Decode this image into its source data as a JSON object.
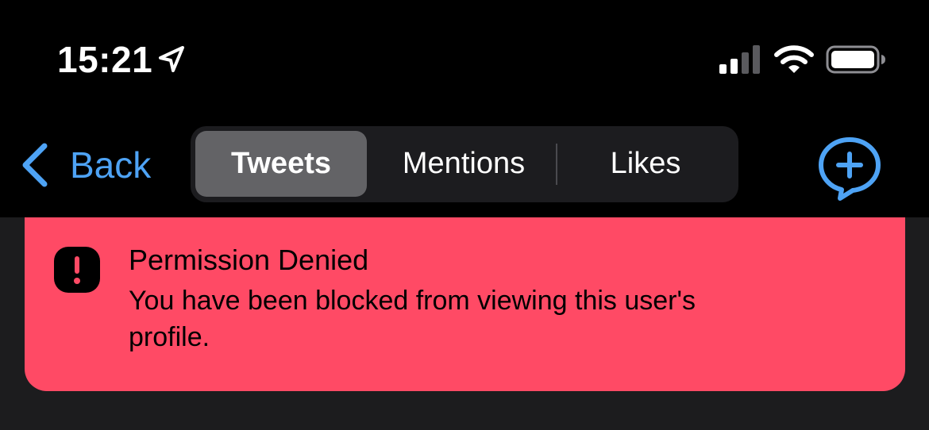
{
  "status_bar": {
    "time": "15:21",
    "location_icon": "location-arrow-icon",
    "signal_icon": "cellular-signal-icon",
    "wifi_icon": "wifi-icon",
    "battery_icon": "battery-icon"
  },
  "nav": {
    "back_label": "Back",
    "back_icon": "chevron-left-icon",
    "compose_icon": "compose-tweet-icon",
    "segments": [
      {
        "label": "Tweets",
        "selected": true
      },
      {
        "label": "Mentions",
        "selected": false
      },
      {
        "label": "Likes",
        "selected": false
      }
    ]
  },
  "alert": {
    "icon": "exclamation-icon",
    "title": "Permission Denied",
    "message": "You have been blocked from viewing this user's profile."
  },
  "colors": {
    "background": "#000000",
    "accent": "#4ea3f5",
    "segment_bg": "#1c1c1f",
    "segment_selected": "#636366",
    "alert_bg": "#ff4a65",
    "content_bg": "#1c1c1e"
  }
}
